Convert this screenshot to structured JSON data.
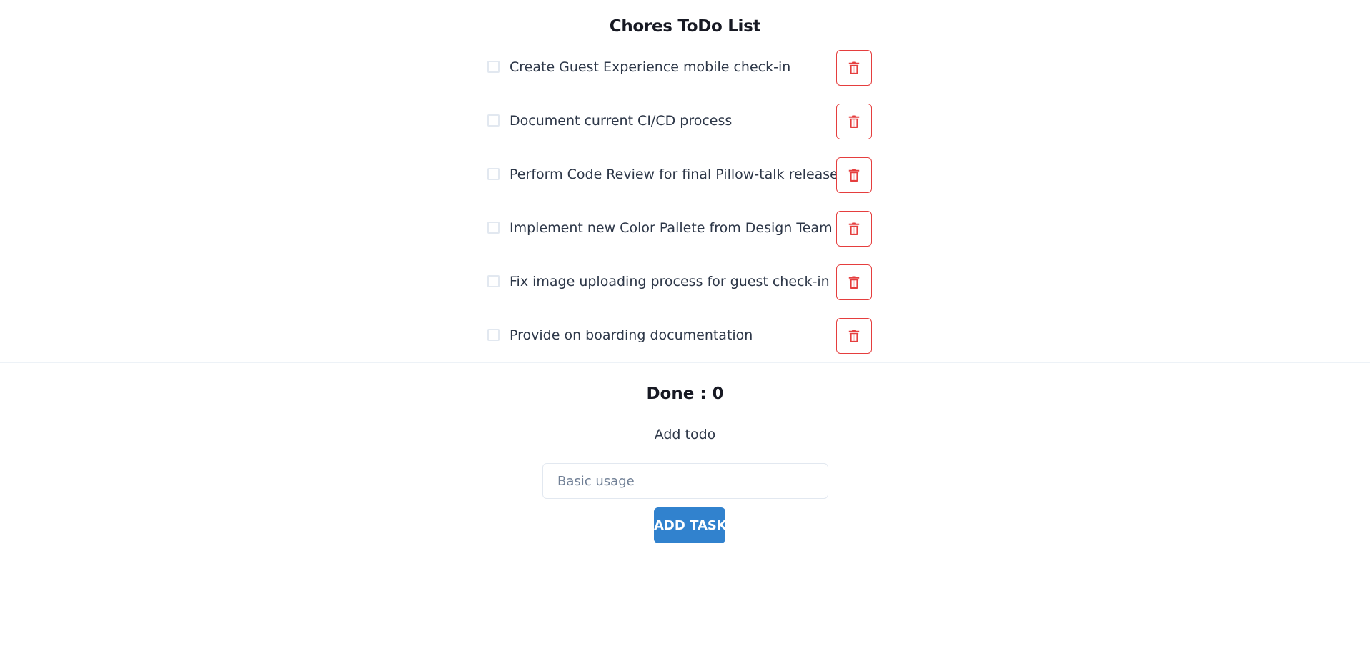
{
  "app": {
    "title": "Chores ToDo List"
  },
  "todos": [
    {
      "label": "Create Guest Experience mobile check-in",
      "checked": false
    },
    {
      "label": "Document current CI/CD process",
      "checked": false
    },
    {
      "label": "Perform Code Review for final Pillow-talk release",
      "checked": false
    },
    {
      "label": "Implement new Color Pallete from Design Team",
      "checked": false
    },
    {
      "label": "Fix image uploading process for guest check-in",
      "checked": false
    },
    {
      "label": "Provide on boarding documentation",
      "checked": false
    }
  ],
  "delete_icon": "trash-icon",
  "summary": {
    "done_text": "Done : 0"
  },
  "add_form": {
    "label": "Add todo",
    "input_value": "",
    "input_placeholder": "Basic usage",
    "button_label": "ADD TASK"
  },
  "colors": {
    "accent": "#3182ce",
    "danger": "#e53e3e",
    "text": "#2d3748",
    "heading": "#171923",
    "border": "#e2e8f0"
  }
}
